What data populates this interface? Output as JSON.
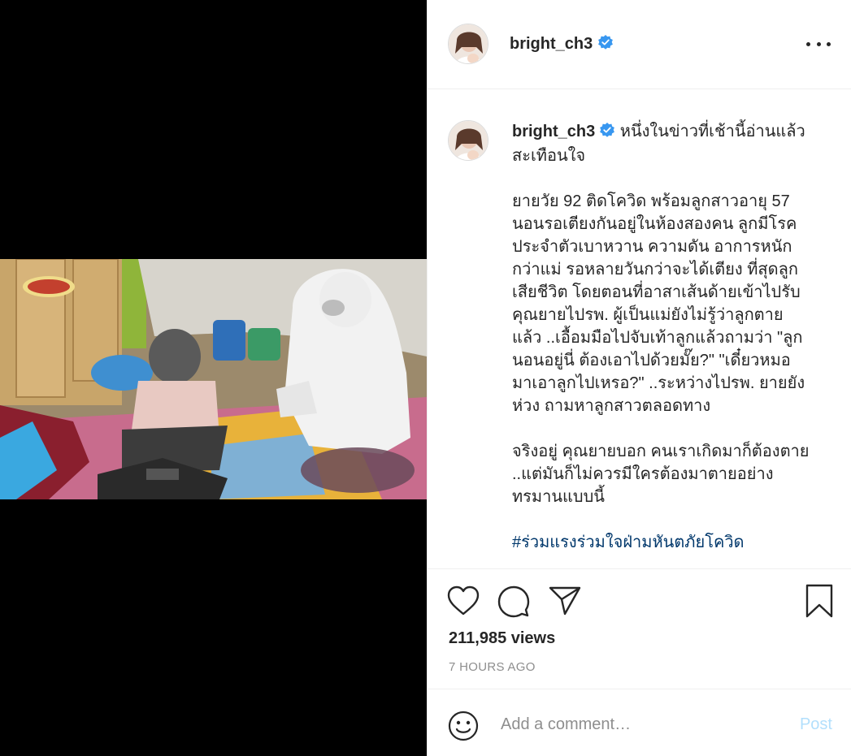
{
  "post": {
    "username": "bright_ch3",
    "verified": true
  },
  "caption": {
    "username": "bright_ch3",
    "first_line": " หนึ่งในข่าวที่เช้านี้อ่านแล้ว\nสะเทือนใจ\n\nยายวัย 92 ติดโควิด พร้อมลูกสาวอายุ 57\nนอนรอเตียงกันอยู่ในห้องสองคน ลูกมีโรค\nประจำตัวเบาหวาน ความดัน อาการหนัก\nกว่าแม่ รอหลายวันกว่าจะได้เตียง ที่สุดลูก\nเสียชีวิต โดยตอนที่อาสาเส้นด้ายเข้าไปรับ\nคุณยายไปรพ. ผู้เป็นแม่ยังไม่รู้ว่าลูกตาย\nแล้ว ..เอื้อมมือไปจับเท้าลูกแล้วถามว่า \"ลูก\nนอนอยู่นี่ ต้องเอาไปด้วยมั๊ย?\" \"เดี๋ยวหมอ\nมาเอาลูกไปเหรอ?\" ..ระหว่างไปรพ. ยายยัง\nห่วง ถามหาลูกสาวตลอดทาง\n\nจริงอยู่ คุณยายบอก คนเราเกิดมาก็ต้องตาย\n..แต่มันก็ไม่ควรมีใครต้องมาตายอย่าง\nทรมานแบบนี้\n\n",
    "hashtag": "#ร่วมแรงร่วมใจฝ่ามหันตภัยโควิด"
  },
  "stats": {
    "views": "211,985 views",
    "time_ago": "7 HOURS AGO"
  },
  "comment": {
    "placeholder": "Add a comment…",
    "post_label": "Post"
  },
  "icons": {
    "like": "heart-icon",
    "comment": "comment-icon",
    "share": "share-icon",
    "save": "bookmark-icon",
    "emoji": "emoji-icon",
    "more": "more-icon",
    "verified": "verified-badge-icon"
  },
  "colors": {
    "verified": "#3897f0",
    "hashtag": "#00376b",
    "post_disabled": "#b2dffc",
    "muted": "#8e8e8e"
  }
}
